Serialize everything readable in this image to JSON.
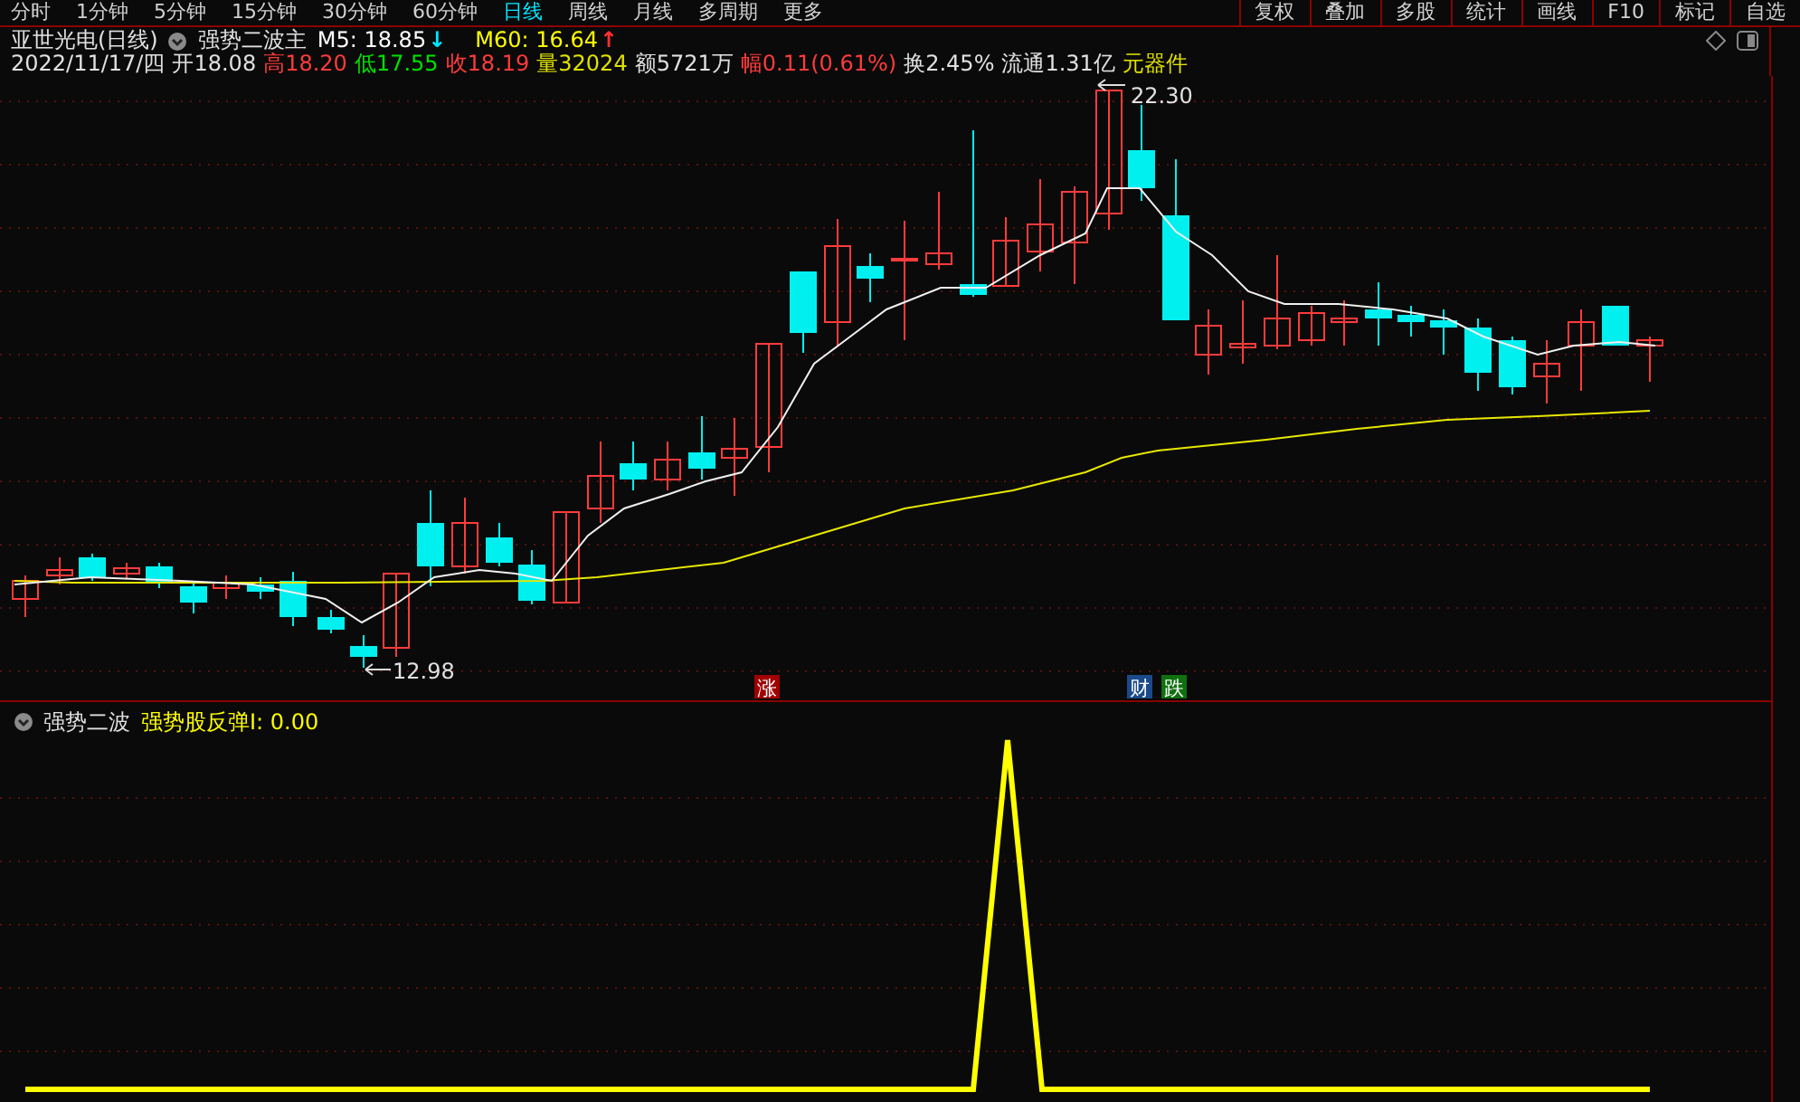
{
  "toolbar": {
    "periods": [
      {
        "label": "分时",
        "selected": false
      },
      {
        "label": "1分钟",
        "selected": false
      },
      {
        "label": "5分钟",
        "selected": false
      },
      {
        "label": "15分钟",
        "selected": false
      },
      {
        "label": "30分钟",
        "selected": false
      },
      {
        "label": "60分钟",
        "selected": false
      },
      {
        "label": "日线",
        "selected": true
      },
      {
        "label": "周线",
        "selected": false
      },
      {
        "label": "月线",
        "selected": false
      },
      {
        "label": "多周期",
        "selected": false
      },
      {
        "label": "更多",
        "selected": false
      }
    ],
    "actions": [
      "复权",
      "叠加",
      "多股",
      "统计",
      "画线",
      "F10",
      "标记",
      "自选"
    ]
  },
  "header": {
    "title": "亚世光电(日线)",
    "formula": "强势二波主",
    "moving_averages": [
      {
        "label": "M5: 18.85",
        "color": "#ffffff",
        "arrow": {
          "text": "↓",
          "color": "#00e5ff"
        }
      },
      {
        "label": "M60: 16.64",
        "color": "#ffff00",
        "arrow": {
          "text": "↑",
          "color": "#ff3030"
        }
      }
    ],
    "quote": [
      {
        "text": "2022/11/17/四",
        "color": "#e0e0e0"
      },
      {
        "text": "开18.08",
        "color": "#e0e0e0"
      },
      {
        "text": "高18.20",
        "color": "#ff3b3b"
      },
      {
        "text": "低17.55",
        "color": "#00e000"
      },
      {
        "text": "收18.19",
        "color": "#ff3b3b"
      },
      {
        "text": "量32024",
        "color": "#e0e000"
      },
      {
        "text": "额5721万",
        "color": "#e0e0e0"
      },
      {
        "text": "幅0.11(0.61%)",
        "color": "#ff3b3b"
      },
      {
        "text": "换2.45%",
        "color": "#e0e0e0"
      },
      {
        "text": "流通1.31亿",
        "color": "#e0e0e0"
      },
      {
        "text": "元器件",
        "color": "#e0e000"
      }
    ]
  },
  "chart": {
    "high_label": "22.30",
    "low_label": "12.98",
    "tags": [
      {
        "text": "涨",
        "color": "#a00000"
      },
      {
        "text": "财",
        "color": "#1a4a8a"
      },
      {
        "text": "跌",
        "color": "#107010"
      }
    ]
  },
  "indicator": {
    "name": "强势二波",
    "reading": "强势股反弹I: 0.00"
  }
}
